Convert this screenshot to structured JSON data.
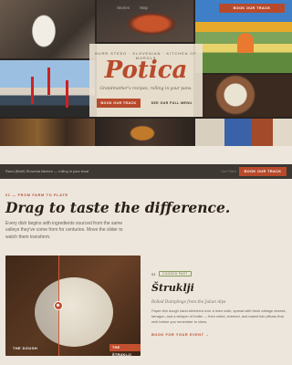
{
  "nav": {
    "items": [
      "Stories",
      "Map"
    ],
    "book_label": "BOOK OUR TRACK"
  },
  "hero": {
    "kicker": "BURR STEED · SLOVENIAN · KITCHEN OF MORGLS",
    "title": "Potica",
    "subtitle": "Grandmother's recipes, rolling in your pans.",
    "primary_btn": "BOOK OUR TRACK",
    "secondary_btn": "SEE OUR FULL MENU"
  },
  "statusbar": {
    "text": "Rand (Brief) Slovenia kitchen — rolling in your bowl",
    "link": "Get Filled",
    "button": "BOOK OUR TRACK"
  },
  "section": {
    "kicker": "01 — FROM FARM TO PLATE",
    "title": "Drag to taste the difference.",
    "lead": "Every dish begins with ingredients sourced from the same valleys they've come from for centuries. Move the slider to watch them transform."
  },
  "slider": {
    "left_label": "THE DOUGH",
    "right_label": "THE ŠTRUKLJI",
    "position_percent": 39
  },
  "dish": {
    "number": "01",
    "badge": "COOKED PAST",
    "title": "Štruklji",
    "subtitle": "Rolled Dumplings from the Julian Alps",
    "description": "Paper-thin dough hand-stretched over a linen cloth, spread with fresh cottage cheese, tarragon, and a whisper of butter — then rolled, cheered, and eased into pillows that melt before you remember to chew.",
    "cta": "BOOK FOR YOUR EVENT →"
  },
  "colors": {
    "accent": "#b84a2c",
    "background": "#ece6dc",
    "bar": "#3e3833"
  }
}
